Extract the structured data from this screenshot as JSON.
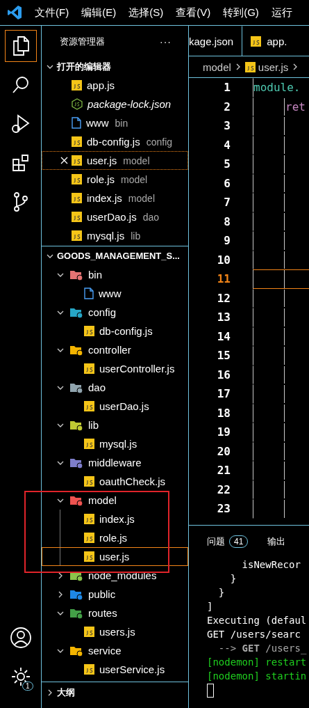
{
  "menu": [
    "文件(F)",
    "编辑(E)",
    "选择(S)",
    "查看(V)",
    "转到(G)",
    "运行"
  ],
  "activity_bar": {
    "top": [
      {
        "kind": "files",
        "selected": true
      },
      {
        "kind": "search",
        "selected": false
      },
      {
        "kind": "debug",
        "selected": false
      },
      {
        "kind": "extensions",
        "selected": false
      },
      {
        "kind": "git",
        "selected": false
      }
    ],
    "bottom": [
      {
        "kind": "account"
      },
      {
        "kind": "settings",
        "badge": "1"
      }
    ]
  },
  "explorer": {
    "title": "资源管理器",
    "more": "···",
    "open_editors": {
      "title": "打开的编辑器",
      "expanded": true,
      "items": [
        {
          "name": "app.js",
          "kind": "js",
          "italic": false,
          "selected": false
        },
        {
          "name": "package-lock.json",
          "kind": "json",
          "italic": true,
          "selected": false
        },
        {
          "name": "www",
          "description": "bin",
          "kind": "file",
          "italic": false,
          "selected": false
        },
        {
          "name": "db-config.js",
          "description": "config",
          "kind": "js",
          "italic": false,
          "selected": false
        },
        {
          "name": "user.js",
          "description": "model",
          "kind": "js",
          "italic": false,
          "selected": true
        },
        {
          "name": "role.js",
          "description": "model",
          "kind": "js",
          "italic": false,
          "selected": false
        },
        {
          "name": "index.js",
          "description": "model",
          "kind": "js",
          "italic": false,
          "selected": false
        },
        {
          "name": "userDao.js",
          "description": "dao",
          "kind": "js",
          "italic": false,
          "selected": false
        },
        {
          "name": "mysql.js",
          "description": "lib",
          "kind": "js",
          "italic": false,
          "selected": false
        }
      ]
    },
    "project": {
      "title": "GOODS_MANAGEMENT_S...",
      "expanded": true,
      "tree": [
        {
          "name": "bin",
          "kind": "folder",
          "color": "#e57373",
          "expanded": true,
          "selected": false,
          "children": [
            {
              "name": "www",
              "kind": "file",
              "selected": false
            }
          ]
        },
        {
          "name": "config",
          "kind": "folder",
          "color": "#26a6c6",
          "expanded": true,
          "selected": false,
          "children": [
            {
              "name": "db-config.js",
              "kind": "js",
              "selected": false
            }
          ]
        },
        {
          "name": "controller",
          "kind": "folder",
          "color": "#f4b400",
          "expanded": true,
          "selected": false,
          "children": [
            {
              "name": "userController.js",
              "kind": "js",
              "selected": false
            }
          ]
        },
        {
          "name": "dao",
          "kind": "folder",
          "color": "#90a4ae",
          "expanded": true,
          "selected": false,
          "children": [
            {
              "name": "userDao.js",
              "kind": "js",
              "selected": false
            }
          ]
        },
        {
          "name": "lib",
          "kind": "folder",
          "color": "#c0ca33",
          "expanded": true,
          "selected": false,
          "children": [
            {
              "name": "mysql.js",
              "kind": "js",
              "selected": false
            }
          ]
        },
        {
          "name": "middleware",
          "kind": "folder",
          "color": "#7e7ecb",
          "expanded": true,
          "selected": false,
          "children": [
            {
              "name": "oauthCheck.js",
              "kind": "js",
              "selected": false
            }
          ]
        },
        {
          "name": "model",
          "kind": "folder",
          "color": "#ef5350",
          "expanded": true,
          "selected": false,
          "children": [
            {
              "name": "index.js",
              "kind": "js",
              "selected": false
            },
            {
              "name": "role.js",
              "kind": "js",
              "selected": false
            },
            {
              "name": "user.js",
              "kind": "js",
              "selected": true
            }
          ]
        },
        {
          "name": "node_modules",
          "kind": "folder",
          "color": "#8bc34a",
          "expanded": false,
          "selected": false
        },
        {
          "name": "public",
          "kind": "folder",
          "color": "#1e88e5",
          "expanded": false,
          "selected": false
        },
        {
          "name": "routes",
          "kind": "folder",
          "color": "#43a047",
          "expanded": true,
          "selected": false,
          "children": [
            {
              "name": "users.js",
              "kind": "js",
              "selected": false
            }
          ]
        },
        {
          "name": "service",
          "kind": "folder",
          "color": "#f4b400",
          "expanded": true,
          "selected": false,
          "children": [
            {
              "name": "userService.js",
              "kind": "js",
              "selected": false
            }
          ]
        }
      ]
    },
    "outline": {
      "title": "大纲",
      "expanded": false
    }
  },
  "editor": {
    "tabs": [
      {
        "label": "kage.json",
        "kind": "none",
        "selected": false
      },
      {
        "label": "app.",
        "kind": "js",
        "selected": false
      }
    ],
    "breadcrumb": [
      "model",
      "user.js"
    ],
    "lines": [
      {
        "number": "1",
        "text": "module.",
        "kind": "keyword",
        "current": false
      },
      {
        "number": "2",
        "text": "ret",
        "kind": "control",
        "current": false
      },
      {
        "number": "3",
        "current": false
      },
      {
        "number": "4",
        "current": false
      },
      {
        "number": "5",
        "current": false
      },
      {
        "number": "6",
        "current": false
      },
      {
        "number": "7",
        "current": false
      },
      {
        "number": "8",
        "current": false
      },
      {
        "number": "9",
        "current": false
      },
      {
        "number": "10",
        "current": false
      },
      {
        "number": "11",
        "current": true
      },
      {
        "number": "12",
        "current": false
      },
      {
        "number": "13",
        "current": false
      },
      {
        "number": "14",
        "current": false
      },
      {
        "number": "15",
        "current": false
      },
      {
        "number": "16",
        "current": false
      },
      {
        "number": "17",
        "current": false
      },
      {
        "number": "18",
        "current": false
      },
      {
        "number": "19",
        "current": false
      },
      {
        "number": "20",
        "current": false
      },
      {
        "number": "21",
        "current": false
      },
      {
        "number": "22",
        "current": false
      },
      {
        "number": "23",
        "current": false
      }
    ]
  },
  "panel": {
    "tabs": [
      {
        "label": "问题",
        "badge": "41",
        "selected": false
      },
      {
        "label": "输出",
        "selected": false
      }
    ],
    "terminal": [
      {
        "text": "      isNewRecor",
        "kind": "plain"
      },
      {
        "text": "    }",
        "kind": "plain"
      },
      {
        "text": "  }",
        "kind": "plain"
      },
      {
        "text": "]",
        "kind": "plain"
      },
      {
        "text": "Executing (defaul",
        "kind": "plain"
      },
      {
        "text": "GET /users/searc",
        "kind": "plain"
      },
      {
        "text": "  --> **GET** /users_",
        "kind": "dim"
      },
      {
        "text": "[nodemon] restart",
        "kind": "green"
      },
      {
        "text": "[nodemon] startin",
        "kind": "green"
      }
    ],
    "cursor": true
  }
}
